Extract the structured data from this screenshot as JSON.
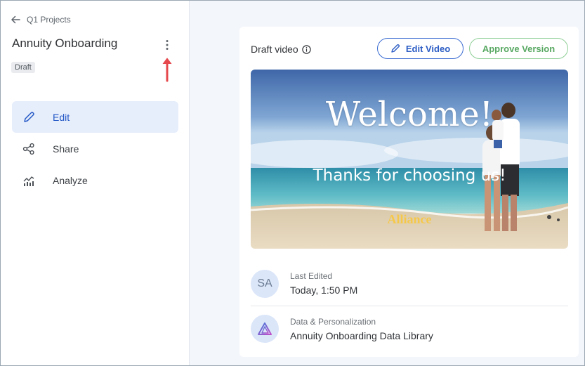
{
  "sidebar": {
    "back_label": "Q1 Projects",
    "project_title": "Annuity Onboarding",
    "status_badge": "Draft",
    "nav": [
      {
        "label": "Edit",
        "icon": "pencil-icon",
        "active": true
      },
      {
        "label": "Share",
        "icon": "share-icon",
        "active": false
      },
      {
        "label": "Analyze",
        "icon": "analytics-icon",
        "active": false
      }
    ]
  },
  "main": {
    "card": {
      "draft_label": "Draft video",
      "edit_button": "Edit Video",
      "approve_button": "Approve Version",
      "video": {
        "headline": "Welcome!",
        "subline": "Thanks for choosing us!",
        "brand": "Alliance"
      },
      "last_edited": {
        "avatar": "SA",
        "label": "Last Edited",
        "value": "Today, 1:50 PM"
      },
      "data": {
        "label": "Data & Personalization",
        "value": "Annuity Onboarding Data Library"
      }
    }
  },
  "colors": {
    "accent": "#2458c6",
    "approve": "#58a862",
    "annotation_arrow": "#e5484d",
    "main_bg": "#f3f6fb"
  }
}
